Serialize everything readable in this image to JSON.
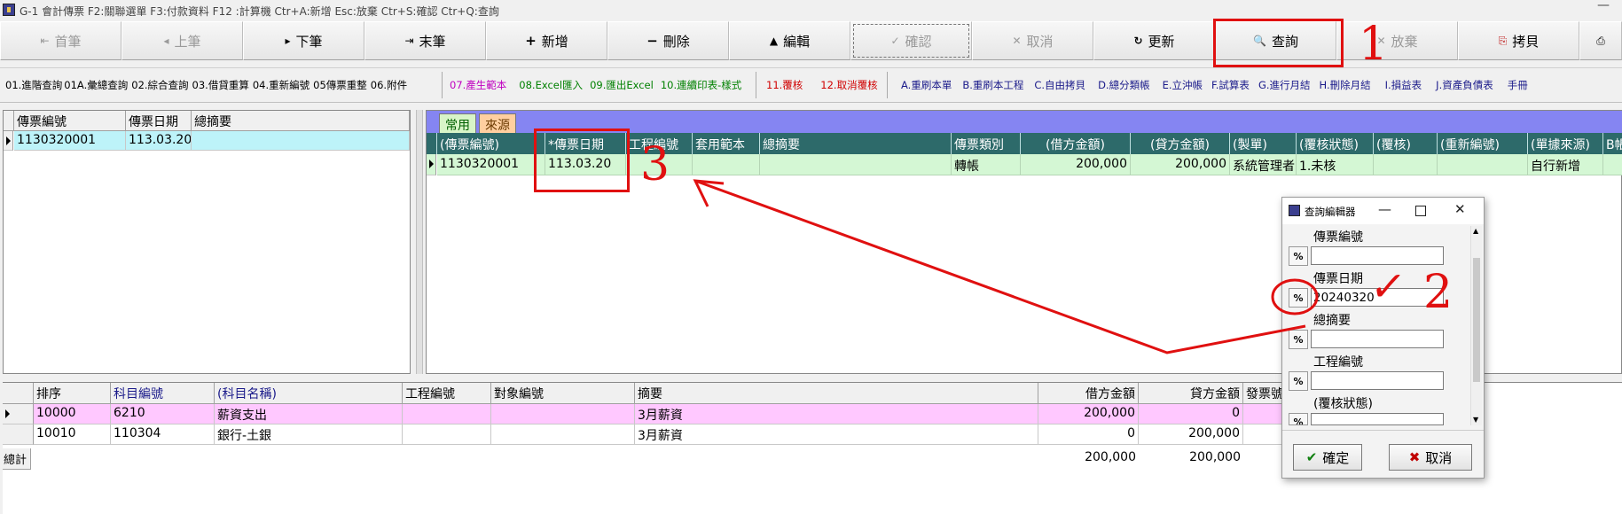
{
  "titlebar": {
    "title": "G-1 會計傳票    F2:關聯選單  F3:付款資料  F12 :計算機  Ctr+A:新增  Esc:放棄  Ctr+S:確認  Ctr+Q:查詢",
    "minimize": "—"
  },
  "toolbar": [
    {
      "label": "首筆",
      "icon": "⇤",
      "enabled": false
    },
    {
      "label": "上筆",
      "icon": "◂",
      "enabled": false
    },
    {
      "label": "下筆",
      "icon": "▸",
      "enabled": true
    },
    {
      "label": "末筆",
      "icon": "⇥",
      "enabled": true
    },
    {
      "label": "新增",
      "icon": "+",
      "enabled": true
    },
    {
      "label": "刪除",
      "icon": "−",
      "enabled": true
    },
    {
      "label": "編輯",
      "icon": "▲",
      "enabled": true
    },
    {
      "label": "確認",
      "icon": "✓",
      "enabled": false
    },
    {
      "label": "取消",
      "icon": "✕",
      "enabled": false
    },
    {
      "label": "更新",
      "icon": "↻",
      "enabled": true
    },
    {
      "label": "查詢",
      "icon": "🔍",
      "enabled": true
    },
    {
      "label": "放棄",
      "icon": "✕",
      "enabled": false
    },
    {
      "label": "拷貝",
      "icon": "⎘",
      "enabled": true
    },
    {
      "label": "",
      "icon": "⎙",
      "enabled": true
    }
  ],
  "funcs": {
    "group1": [
      "01.進階查詢",
      "01A.彙總查詢",
      "02.綜合查詢",
      "03.借貸重算",
      "04.重新編號",
      "05傳票重整",
      "06.附件"
    ],
    "group2": {
      "magenta": "07.產生範本",
      "green": [
        "08.Excel匯入",
        "09.匯出Excel",
        "10.連續印表-樣式"
      ]
    },
    "group3": [
      "11.覆核",
      "12.取消覆核"
    ],
    "group4": [
      "A.重刷本單",
      "B.重刷本工程",
      "C.自由拷貝",
      "D.總分類帳",
      "E.立沖帳",
      "F.試算表",
      "G.進行月結",
      "H.刪除月結",
      "I.損益表",
      "J.資產負債表",
      "手冊"
    ]
  },
  "left_grid": {
    "headers": [
      "傳票編號",
      "傳票日期",
      "總摘要"
    ],
    "rows": [
      [
        "1130320001",
        "113.03.20",
        ""
      ]
    ]
  },
  "right_panel": {
    "tabs": [
      "常用",
      "來源"
    ],
    "headers": [
      "(傳票編號)",
      "*傳票日期",
      "工程編號",
      "套用範本",
      "總摘要",
      "傳票類別",
      "(借方金額)",
      "(貸方金額)",
      "(製單)",
      "(覆核狀態)",
      "(覆核)",
      "(重新編號)",
      "(單據來源)",
      "B帳"
    ],
    "row": [
      "1130320001",
      "113.03.20",
      "",
      "",
      "",
      "轉帳",
      "200,000",
      "200,000",
      "系統管理者",
      "1.未核",
      "",
      "",
      "自行新增",
      ""
    ]
  },
  "bottom_grid": {
    "headers": [
      "排序",
      "科目編號",
      "(科目名稱)",
      "工程編號",
      "對象編號",
      "摘要",
      "借方金額",
      "貸方金額",
      "發票號"
    ],
    "rows": [
      [
        "10000",
        "6210",
        "薪資支出",
        "",
        "",
        "3月薪資",
        "200,000",
        "0"
      ],
      [
        "10010",
        "110304",
        "銀行-土銀",
        "",
        "",
        "3月薪資",
        "0",
        "200,000"
      ]
    ],
    "total_label": "總計",
    "total_debit": "200,000",
    "total_credit": "200,000"
  },
  "query_dialog": {
    "title": "查詢編輯器",
    "fields": [
      {
        "label": "傳票編號",
        "value": ""
      },
      {
        "label": "傳票日期",
        "value": "20240320"
      },
      {
        "label": "總摘要",
        "value": ""
      },
      {
        "label": "工程編號",
        "value": ""
      },
      {
        "label": "(覆核狀態)",
        "value": ""
      }
    ],
    "pct_label": "%",
    "ok_label": "確定",
    "cancel_label": "取消"
  },
  "annotations": {
    "n1": "1",
    "n2": "2",
    "n3": "3",
    "check": "✓"
  },
  "colors": {
    "annotation_red": "#e01010",
    "tabbar": "#8585f2",
    "header_teal": "#2d6a6a",
    "row_green": "#d4f7d4",
    "row_pink": "#ffc8ff",
    "row_cyan": "#bdf3f9"
  }
}
